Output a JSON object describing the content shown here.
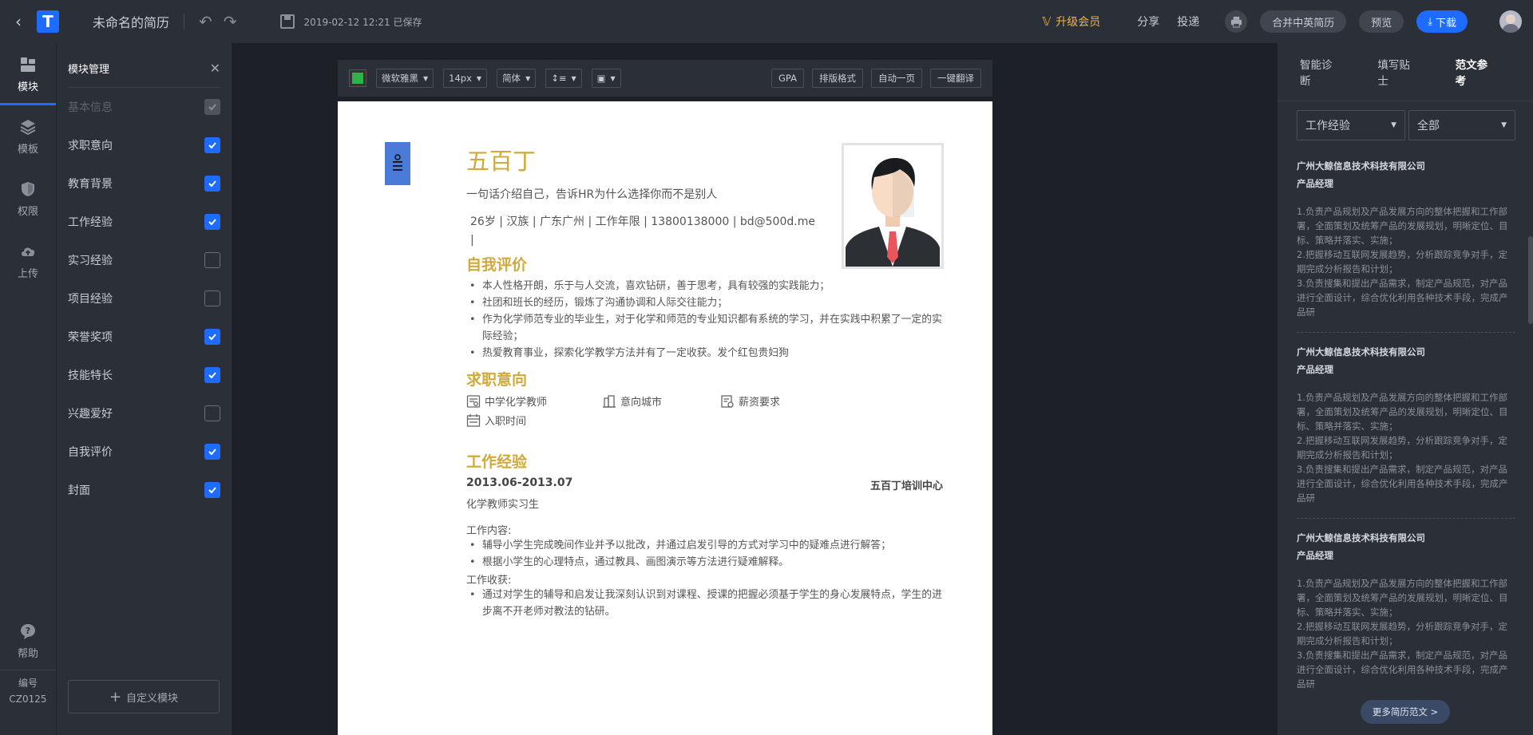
{
  "topbar": {
    "doc_title": "未命名的简历",
    "save_status": "2019-02-12 12:21 已保存",
    "vip_label": "升级会员",
    "share_label": "分享",
    "deliver_label": "投递",
    "merge_label": "合并中英简历",
    "preview_label": "预览",
    "download_label": "下载"
  },
  "rail": {
    "items": [
      {
        "label": "模块",
        "icon": "blocks-icon"
      },
      {
        "label": "模板",
        "icon": "layers-icon"
      },
      {
        "label": "权限",
        "icon": "shield-icon"
      },
      {
        "label": "上传",
        "icon": "cloud-upload-icon"
      }
    ],
    "help_label": "帮助",
    "code_label": "编号",
    "code_value": "CZ0125"
  },
  "modules": {
    "title": "模块管理",
    "items": [
      {
        "label": "基本信息",
        "checked": true,
        "disabled": true
      },
      {
        "label": "求职意向",
        "checked": true
      },
      {
        "label": "教育背景",
        "checked": true
      },
      {
        "label": "工作经验",
        "checked": true
      },
      {
        "label": "实习经验",
        "checked": false
      },
      {
        "label": "项目经验",
        "checked": false
      },
      {
        "label": "荣誉奖项",
        "checked": true
      },
      {
        "label": "技能特长",
        "checked": true
      },
      {
        "label": "兴趣爱好",
        "checked": false
      },
      {
        "label": "自我评价",
        "checked": true
      },
      {
        "label": "封面",
        "checked": true
      }
    ],
    "custom_label": "自定义模块"
  },
  "format_bar": {
    "color": "#2db34a",
    "font": "微软雅黑",
    "size": "14px",
    "script": "简体",
    "buttons": [
      "GPA",
      "排版格式",
      "自动一页",
      "一键翻译"
    ]
  },
  "resume": {
    "name": "五百丁",
    "tagline": "一句话介绍自己，告诉HR为什么选择你而不是别人",
    "basic_info": "26岁 | 汉族 | 广东广州 | 工作年限 | 13800138000 | bd@500d.me |",
    "self_eval": {
      "title": "自我评价",
      "items": [
        "本人性格开朗，乐于与人交流，喜欢钻研，善于思考，具有较强的实践能力；",
        "社团和班长的经历，锻炼了沟通协调和人际交往能力；",
        "作为化学师范专业的毕业生，对于化学和师范的专业知识都有系统的学习，并在实践中积累了一定的实际经验；",
        "热爱教育事业，探索化学教学方法并有了一定收获。发个红包贵妇狗"
      ]
    },
    "intent": {
      "title": "求职意向",
      "position": "中学化学教师",
      "city": "意向城市",
      "salary": "薪资要求",
      "entry": "入职时间"
    },
    "work": {
      "title": "工作经验",
      "date": "2013.06-2013.07",
      "company": "五百丁培训中心",
      "role": "化学教师实习生",
      "content_label": "工作内容:",
      "content_items": [
        "辅导小学生完成晚间作业并予以批改，并通过启发引导的方式对学习中的疑难点进行解答；",
        "根据小学生的心理特点，通过教具、画图演示等方法进行疑难解释。"
      ],
      "gain_label": "工作收获:",
      "gain_items": [
        "通过对学生的辅导和启发让我深刻认识到对课程、授课的把握必须基于学生的身心发展特点，学生的进步离不开老师对教法的钻研。"
      ]
    }
  },
  "right_panel": {
    "tabs": [
      "智能诊断",
      "填写贴士",
      "范文参考"
    ],
    "active_tab": 2,
    "filter_category": "工作经验",
    "filter_scope": "全部",
    "cards": [
      {
        "company": "广州大鲸信息技术科技有限公司",
        "position": "产品经理",
        "desc": "1.负责产品规划及产品发展方向的整体把握和工作部署，全面策划及统筹产品的发展规划，明晰定位、目标、策略并落实、实施；\n2.把握移动互联网发展趋势，分析跟踪竞争对手，定期完成分析报告和计划；\n3.负责搜集和提出产品需求，制定产品规范，对产品进行全面设计，综合优化利用各种技术手段，完成产品研"
      },
      {
        "company": "广州大鲸信息技术科技有限公司",
        "position": "产品经理",
        "desc": "1.负责产品规划及产品发展方向的整体把握和工作部署，全面策划及统筹产品的发展规划，明晰定位、目标、策略并落实、实施；\n2.把握移动互联网发展趋势，分析跟踪竞争对手，定期完成分析报告和计划；\n3.负责搜集和提出产品需求，制定产品规范，对产品进行全面设计，综合优化利用各种技术手段，完成产品研"
      },
      {
        "company": "广州大鲸信息技术科技有限公司",
        "position": "产品经理",
        "desc": "1.负责产品规划及产品发展方向的整体把握和工作部署，全面策划及统筹产品的发展规划，明晰定位、目标、策略并落实、实施；\n2.把握移动互联网发展趋势，分析跟踪竞争对手，定期完成分析报告和计划；\n3.负责搜集和提出产品需求，制定产品规范，对产品进行全面设计，综合优化利用各种技术手段，完成产品研"
      }
    ],
    "more_label": "更多简历范文 >"
  }
}
